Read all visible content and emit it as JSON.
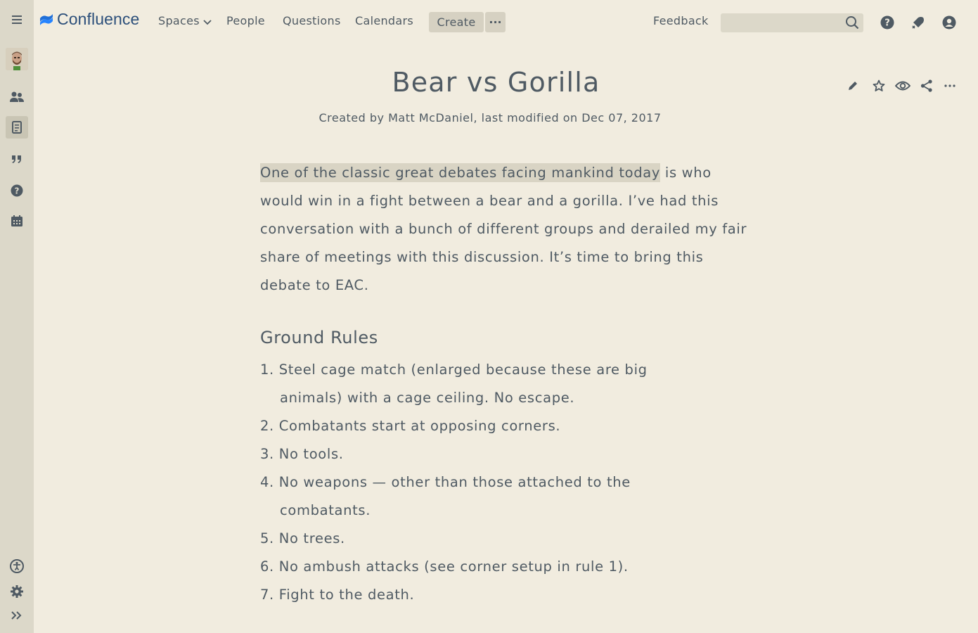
{
  "nav": {
    "logo_text": "Confluence",
    "spaces": "Spaces",
    "people": "People",
    "questions": "Questions",
    "calendars": "Calendars",
    "create": "Create",
    "more": "···",
    "feedback": "Feedback",
    "search_placeholder": ""
  },
  "page": {
    "title": "Bear vs Gorilla",
    "byline": "Created by Matt McDaniel, last modified on Dec 07, 2017",
    "intro_highlight": "One of the classic great debates facing mankind today",
    "intro_rest": " is who would win in a fight between a bear and a gorilla. I’ve had this conversation with a bunch of different groups and derailed my fair share of meetings with this discussion. It’s time to bring this debate to EAC.",
    "section_heading": "Ground Rules",
    "rules": [
      "1. Steel cage match (enlarged because these are big animals) with a cage ceiling. No escape.",
      "2. Combatants start at opposing corners.",
      "3. No tools.",
      "4. No weapons — other than those attached to the combatants.",
      "5. No trees.",
      "6. No ambush attacks (see corner setup in rule 1).",
      "7. Fight to the death."
    ]
  },
  "colors": {
    "background": "#f1ecdf",
    "sidebar": "#dcd8c9",
    "text": "#4f5a63",
    "brand": "#2c4f7a",
    "highlight": "#d9d4c4"
  },
  "icons": {
    "sidebar": [
      "menu-icon",
      "people-icon",
      "page-icon",
      "quote-icon",
      "help-icon",
      "calendar-icon",
      "accessibility-icon",
      "settings-icon",
      "expand-icon"
    ],
    "top": [
      "search-icon",
      "help-icon",
      "notifications-icon",
      "user-icon"
    ],
    "page_actions": [
      "edit-icon",
      "star-icon",
      "watch-icon",
      "share-icon",
      "more-icon"
    ]
  }
}
